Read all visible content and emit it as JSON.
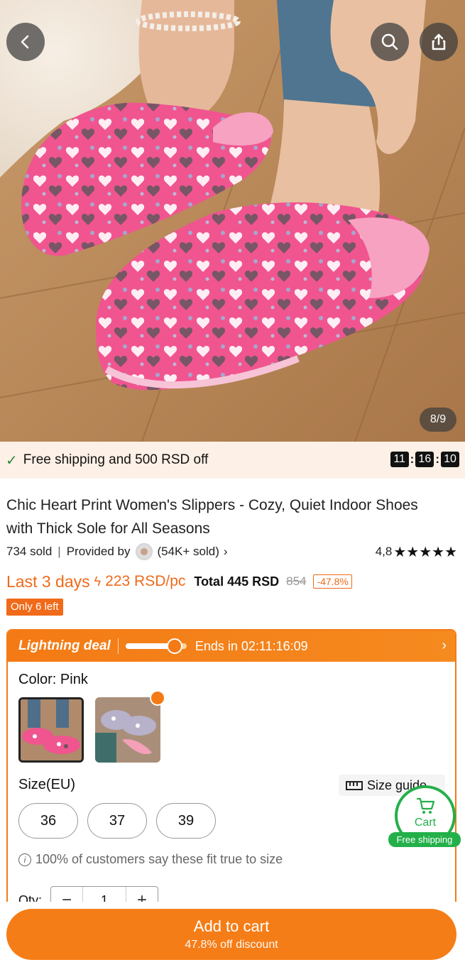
{
  "gallery": {
    "counter": "8/9"
  },
  "promo_strip": {
    "text": "Free shipping and 500 RSD off",
    "timer": [
      "11",
      "16",
      "10"
    ]
  },
  "product": {
    "title": "Chic Heart Print Women's Slippers - Cozy, Quiet Indoor Shoes with Thick Sole for All Seasons",
    "sold": "734 sold",
    "provided_by": "Provided by",
    "seller_sold": "(54K+ sold)",
    "rating": "4,8",
    "stars": "★★★★★",
    "last_days": "Last 3 days",
    "unit_price": "223 RSD/pc",
    "total": "Total 445 RSD",
    "old_price": "854",
    "discount": "-47.8%",
    "stock": "Only 6 left"
  },
  "deal": {
    "title": "Lightning deal",
    "ends": "Ends in 02:11:16:09",
    "progress": 0.8
  },
  "options": {
    "color_label": "Color: Pink",
    "size_label": "Size(EU)",
    "size_guide": "Size guide",
    "sizes": [
      "36",
      "37",
      "39"
    ],
    "fit_note": "100% of customers say these fit true to size",
    "qty_label": "Qty:",
    "qty_value": "1"
  },
  "floating_cart": {
    "label": "Cart",
    "badge": "Free shipping"
  },
  "cta": {
    "label": "Add to cart",
    "sub": "47.8% off discount"
  },
  "colors": {
    "accent": "#f57d17",
    "success": "#23b04a",
    "product_pink": "#f0558f"
  }
}
